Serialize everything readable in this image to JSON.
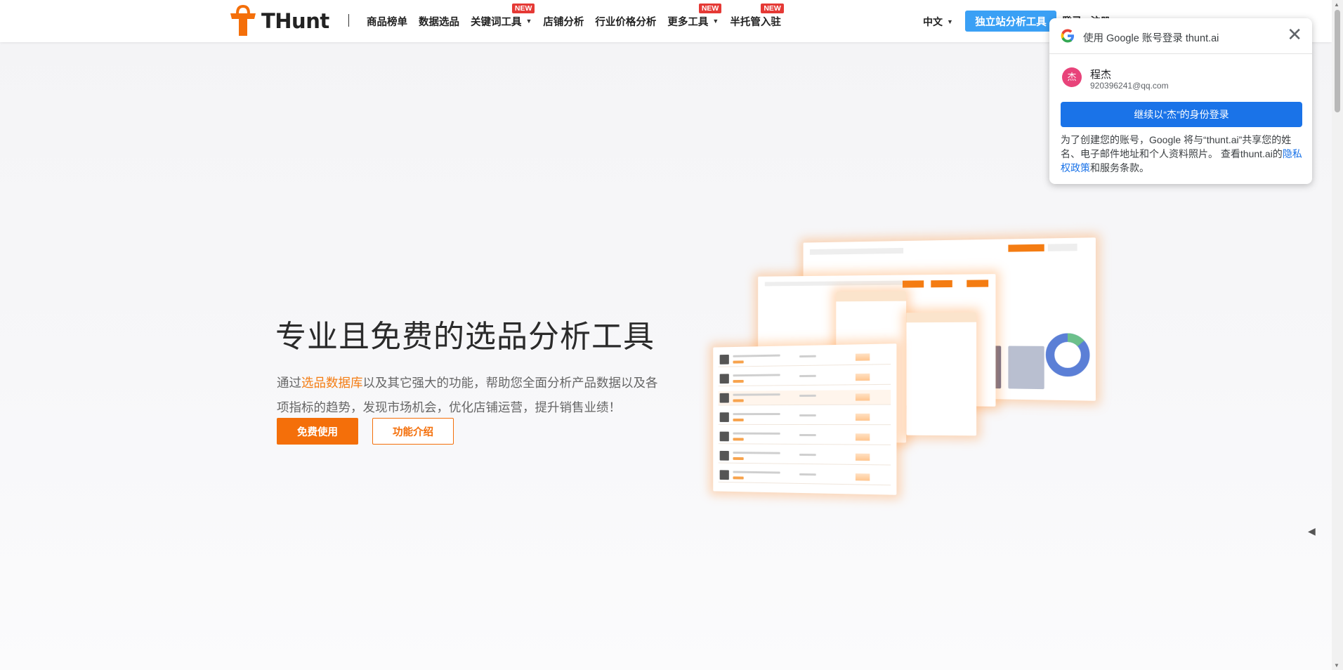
{
  "nav": {
    "brand": "THunt",
    "items": [
      {
        "label": "商品榜单",
        "dropdown": false,
        "badge": ""
      },
      {
        "label": "数据选品",
        "dropdown": false,
        "badge": ""
      },
      {
        "label": "关键词工具",
        "dropdown": true,
        "badge": "NEW"
      },
      {
        "label": "店铺分析",
        "dropdown": false,
        "badge": ""
      },
      {
        "label": "行业价格分析",
        "dropdown": false,
        "badge": ""
      },
      {
        "label": "更多工具",
        "dropdown": true,
        "badge": "NEW"
      },
      {
        "label": "半托管入驻",
        "dropdown": false,
        "badge": "NEW"
      }
    ],
    "language": "中文",
    "cta": "独立站分析工具",
    "login": "登录 · 注册"
  },
  "hero": {
    "title": "专业且免费的选品分析工具",
    "desc_prefix": "通过",
    "desc_highlight": "选品数据库",
    "desc_suffix": "以及其它强大的功能，帮助您全面分析产品数据以及各项指标的趋势，发现市场机会，优化店铺运营，提升销售业绩！",
    "primary_button": "免费使用",
    "secondary_button": "功能介绍"
  },
  "google_popup": {
    "title": "使用 Google 账号登录 thunt.ai",
    "avatar_initial": "杰",
    "account_name": "程杰",
    "account_email": "920396241@qq.com",
    "continue_button": "继续以“杰”的身份登录",
    "disclaimer": "为了创建您的账号，Google 将与“thunt.ai”共享您的姓名、电子邮件地址和个人资料照片。 查看thunt.ai的",
    "privacy_link": "隐私权政策",
    "disclaimer_end": "和服务条款。"
  },
  "colors": {
    "brand_orange": "#f46f0a",
    "highlight_orange": "#f47c12",
    "cta_blue": "#3aa0f5",
    "google_blue": "#1a73e8",
    "badge_red": "#e53935"
  }
}
